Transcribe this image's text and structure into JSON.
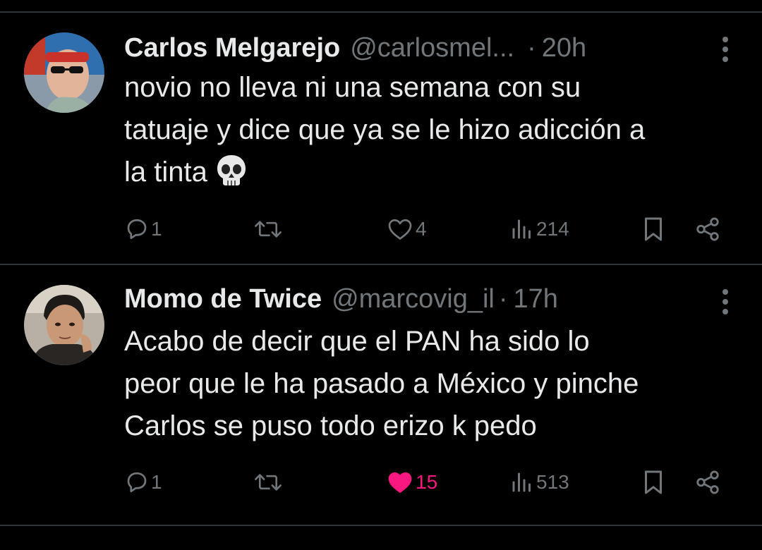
{
  "tweets": [
    {
      "name": "Carlos Melgarejo",
      "handle": "@carlosmel...",
      "separator": "·",
      "time": "20h",
      "text_lines": [
        "novio no lleva ni una semana con su",
        "tatuaje y dice que ya se le hizo adicción a",
        "la tinta"
      ],
      "emoji": "skull-emoji",
      "replies": "1",
      "likes": "4",
      "liked": false,
      "views": "214",
      "avatar": "avatar-red-bandana-sunglasses"
    },
    {
      "name": "Momo de Twice",
      "handle": "@marcovig_il",
      "separator": "·",
      "time": "17h",
      "text_lines": [
        "Acabo de decir que el PAN ha sido lo",
        "peor que le ha pasado a México y pinche",
        "Carlos se puso todo erizo k pedo"
      ],
      "replies": "1",
      "likes": "15",
      "liked": true,
      "views": "513",
      "avatar": "avatar-man-dark-hair"
    }
  ],
  "colors": {
    "background": "#000000",
    "text": "#e7e9ea",
    "secondary": "#71767b",
    "divider": "#2f3336",
    "like": "#f91880"
  },
  "icons": [
    "reply-icon",
    "repost-icon",
    "like-icon",
    "views-icon",
    "bookmark-icon",
    "share-icon",
    "more-icon"
  ]
}
